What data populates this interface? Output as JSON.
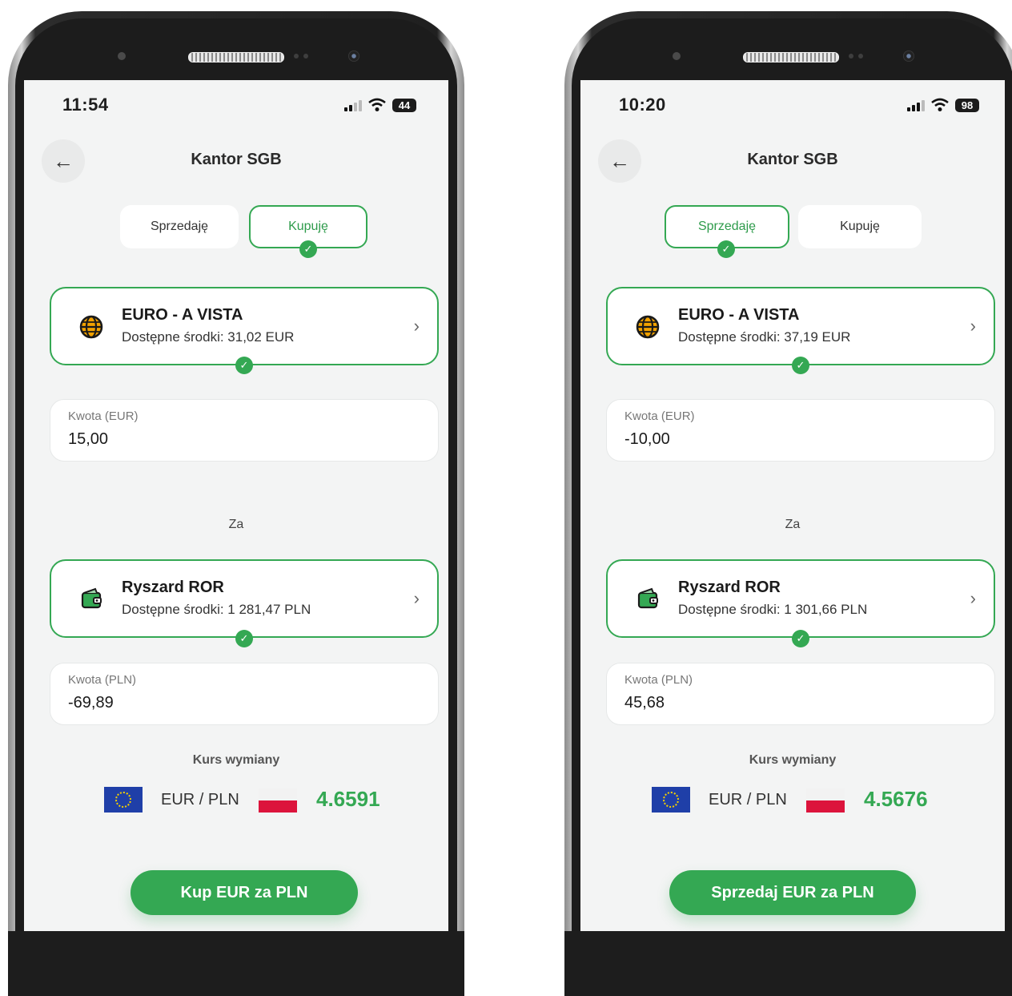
{
  "phones": [
    {
      "status": {
        "time": "11:54",
        "battery": "44"
      },
      "header": {
        "title": "Kantor SGB"
      },
      "toggle": {
        "sell_label": "Sprzedaję",
        "buy_label": "Kupuję",
        "active": "buy"
      },
      "source_account": {
        "name": "EURO - A VISTA",
        "available": "Dostępne środki: 31,02 EUR"
      },
      "source_amount": {
        "label": "Kwota (EUR)",
        "value": "15,00"
      },
      "separator": "Za",
      "target_account": {
        "name": "Ryszard ROR",
        "available": "Dostępne środki: 1 281,47 PLN"
      },
      "target_amount": {
        "label": "Kwota (PLN)",
        "value": "-69,89"
      },
      "exchange": {
        "label": "Kurs wymiany",
        "pair": "EUR / PLN",
        "rate": "4.6591"
      },
      "action": {
        "label": "Kup EUR za PLN"
      }
    },
    {
      "status": {
        "time": "10:20",
        "battery": "98"
      },
      "header": {
        "title": "Kantor SGB"
      },
      "toggle": {
        "sell_label": "Sprzedaję",
        "buy_label": "Kupuję",
        "active": "sell"
      },
      "source_account": {
        "name": "EURO - A VISTA",
        "available": "Dostępne środki: 37,19 EUR"
      },
      "source_amount": {
        "label": "Kwota (EUR)",
        "value": "-10,00"
      },
      "separator": "Za",
      "target_account": {
        "name": "Ryszard ROR",
        "available": "Dostępne środki: 1 301,66 PLN"
      },
      "target_amount": {
        "label": "Kwota (PLN)",
        "value": "45,68"
      },
      "exchange": {
        "label": "Kurs wymiany",
        "pair": "EUR / PLN",
        "rate": "4.5676"
      },
      "action": {
        "label": "Sprzedaj EUR za PLN"
      }
    }
  ],
  "colors": {
    "accent": "#34a853",
    "background": "#f3f4f4"
  }
}
